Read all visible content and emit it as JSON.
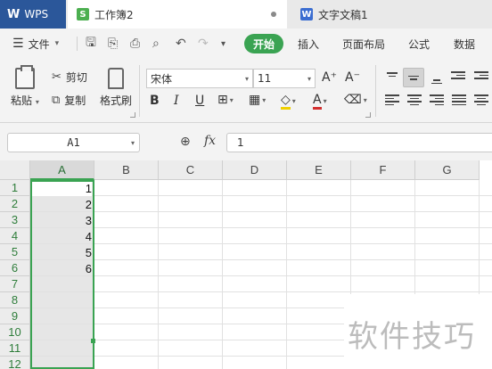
{
  "tabs": {
    "wps": "WPS",
    "workbook": "工作簿2",
    "document": "文字文稿1"
  },
  "menu": {
    "file": "文件",
    "start": "开始",
    "items": [
      "插入",
      "页面布局",
      "公式",
      "数据"
    ]
  },
  "ribbon": {
    "paste": "粘贴",
    "cut": "剪切",
    "copy": "复制",
    "format_painter": "格式刷",
    "font_name": "宋体",
    "font_size": "11"
  },
  "formula_bar": {
    "name_box": "A1",
    "fx": "fx",
    "value": "1"
  },
  "sheet": {
    "columns": [
      "A",
      "B",
      "C",
      "D",
      "E",
      "F",
      "G"
    ],
    "rows": [
      "1",
      "2",
      "3",
      "4",
      "5",
      "6",
      "7",
      "8",
      "9",
      "10",
      "11",
      "12"
    ],
    "column_a_values": [
      "1",
      "2",
      "3",
      "4",
      "5",
      "6"
    ]
  },
  "watermark": "软件技巧",
  "colors": {
    "accent": "#3aa352",
    "wps_tab": "#2b579a"
  }
}
